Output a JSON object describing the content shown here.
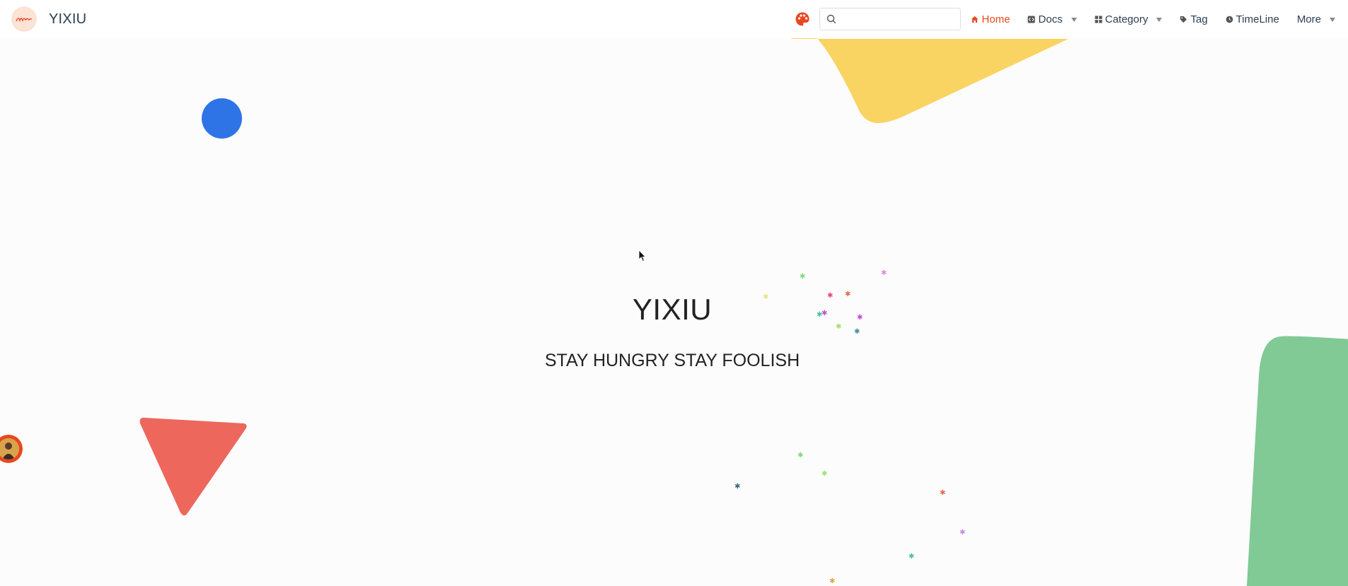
{
  "site": {
    "title": "YIXIU"
  },
  "nav": {
    "search": {
      "placeholder": "",
      "value": ""
    },
    "items": [
      {
        "label": "Home",
        "icon": "home-icon",
        "active": true
      },
      {
        "label": "Docs",
        "icon": "code-icon",
        "dropdown": true
      },
      {
        "label": "Category",
        "icon": "grid-icon",
        "dropdown": true
      },
      {
        "label": "Tag",
        "icon": "tag-icon"
      },
      {
        "label": "TimeLine",
        "icon": "clock-icon"
      },
      {
        "label": "More",
        "dropdown": true
      }
    ]
  },
  "hero": {
    "title": "YIXIU",
    "tagline": "STAY HUNGRY STAY FOOLISH"
  },
  "colors": {
    "accent": "#e8481f",
    "text": "#2c3e50",
    "yellow_shape": "#f9d462",
    "blue_shape": "#2f74e6",
    "red_shape": "#ee675c",
    "green_shape": "#81c995"
  }
}
